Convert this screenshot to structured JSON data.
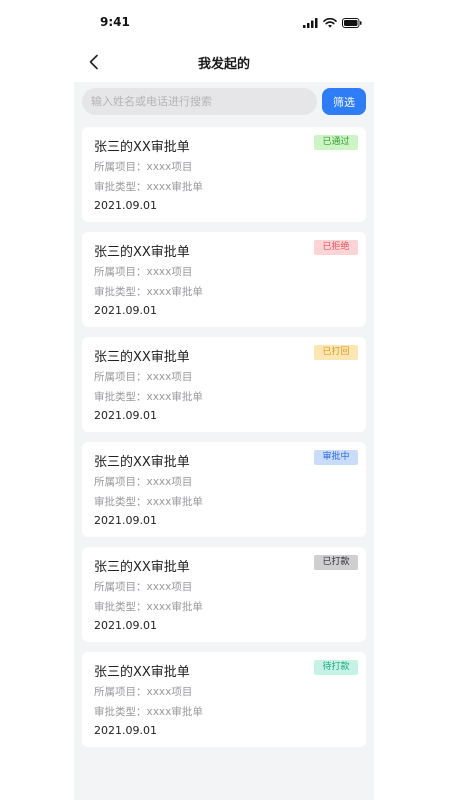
{
  "status_bar": {
    "time": "9:41",
    "icons": [
      "signal-icon",
      "wifi-icon",
      "battery-icon"
    ]
  },
  "nav": {
    "title": "我发起的",
    "back_icon": "chevron-left-icon"
  },
  "search": {
    "placeholder": "输入姓名或电话进行搜索",
    "value": "",
    "filter_label": "筛选"
  },
  "colors": {
    "accent": "#2e7cf6",
    "page_bg": "#f3f4f6"
  },
  "approvals": [
    {
      "title": "张三的XX审批单",
      "project_label": "所属项目：",
      "project": "xxxx项目",
      "type_label": "审批类型：",
      "type": "xxxx审批单",
      "date": "2021.09.01",
      "status": "已通过",
      "status_bg": "#ccf5c4",
      "status_color": "#3a9a35"
    },
    {
      "title": "张三的XX审批单",
      "project_label": "所属项目：",
      "project": "xxxx项目",
      "type_label": "审批类型：",
      "type": "xxxx审批单",
      "date": "2021.09.01",
      "status": "已拒绝",
      "status_bg": "#fcd4d6",
      "status_color": "#e2575f"
    },
    {
      "title": "张三的XX审批单",
      "project_label": "所属项目：",
      "project": "xxxx项目",
      "type_label": "审批类型：",
      "type": "xxxx审批单",
      "date": "2021.09.01",
      "status": "已打回",
      "status_bg": "#fce7b4",
      "status_color": "#d99a1e"
    },
    {
      "title": "张三的XX审批单",
      "project_label": "所属项目：",
      "project": "xxxx项目",
      "type_label": "审批类型：",
      "type": "xxxx审批单",
      "date": "2021.09.01",
      "status": "审批中",
      "status_bg": "#c9ddfb",
      "status_color": "#2e6bd6"
    },
    {
      "title": "张三的XX审批单",
      "project_label": "所属项目：",
      "project": "xxxx项目",
      "type_label": "审批类型：",
      "type": "xxxx审批单",
      "date": "2021.09.01",
      "status": "已打款",
      "status_bg": "#cfcfd2",
      "status_color": "#333333"
    },
    {
      "title": "张三的XX审批单",
      "project_label": "所属项目：",
      "project": "xxxx项目",
      "type_label": "审批类型：",
      "type": "xxxx审批单",
      "date": "2021.09.01",
      "status": "待打款",
      "status_bg": "#c4f2e4",
      "status_color": "#1fa983"
    }
  ]
}
